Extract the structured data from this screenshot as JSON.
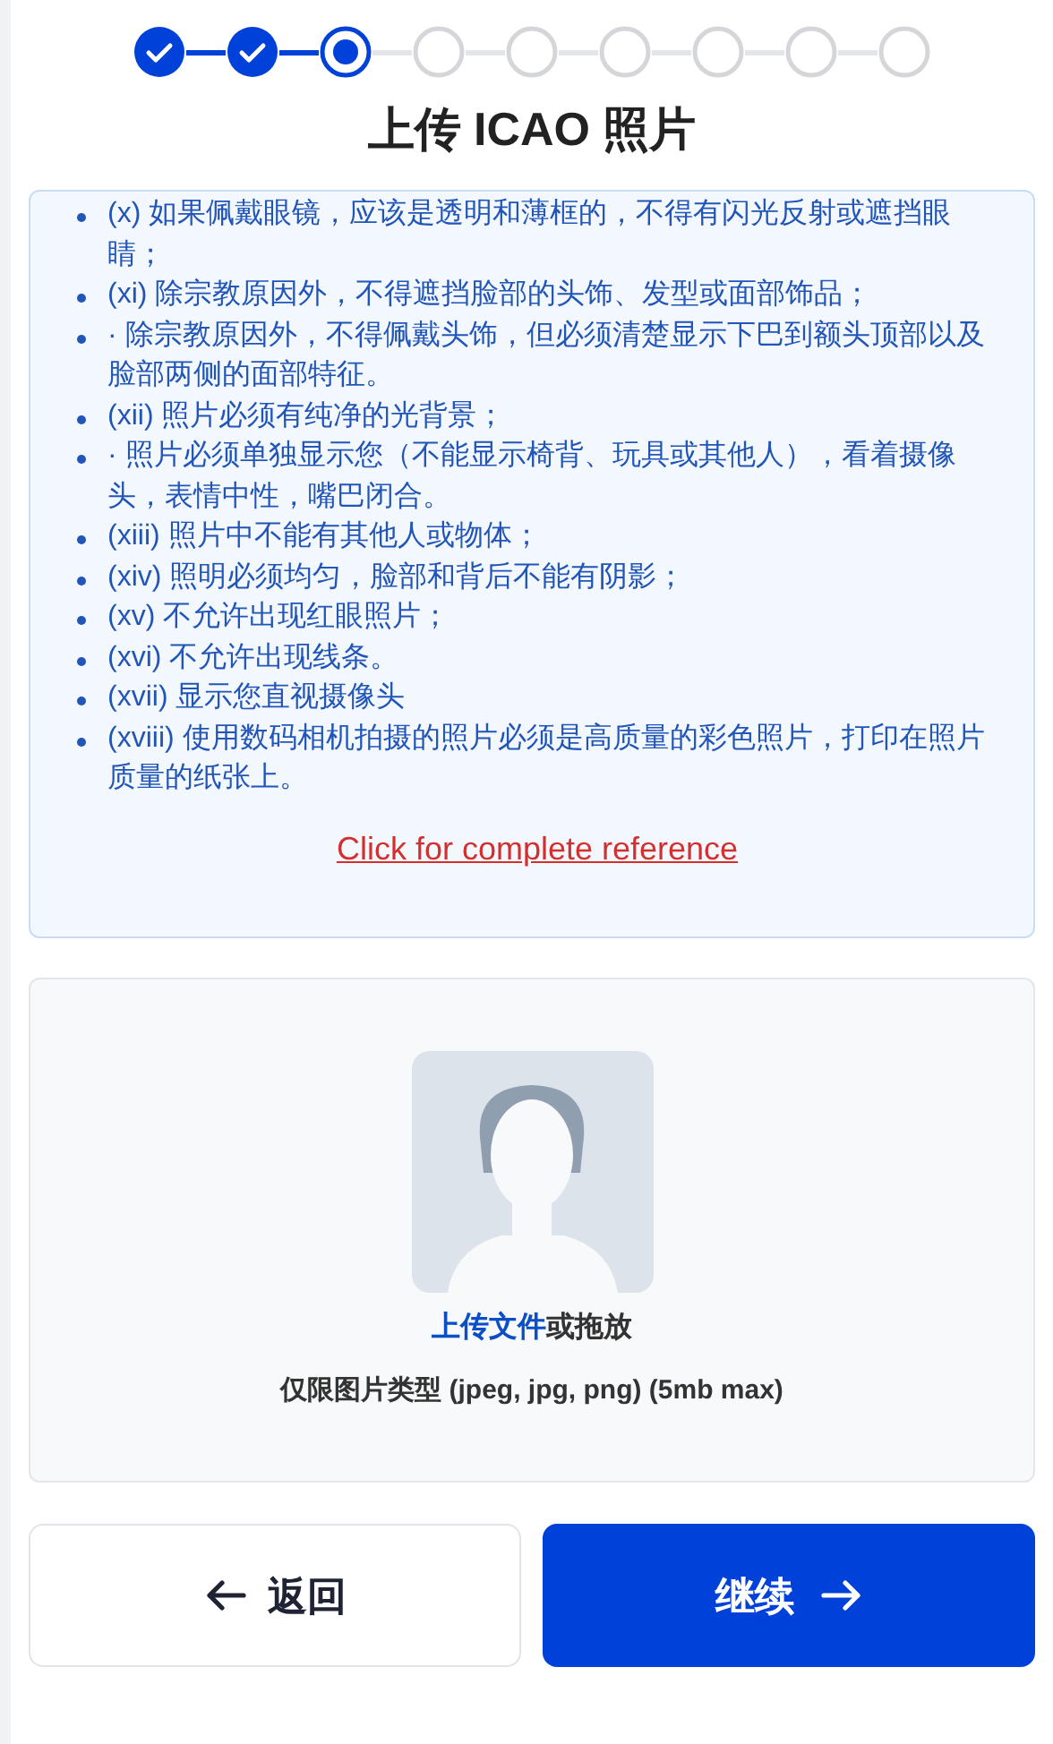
{
  "stepper": {
    "steps": [
      {
        "completed": true,
        "selected": false
      },
      {
        "completed": true,
        "selected": false
      },
      {
        "completed": false,
        "selected": true
      },
      {
        "completed": false,
        "selected": false
      },
      {
        "completed": false,
        "selected": false
      },
      {
        "completed": false,
        "selected": false
      },
      {
        "completed": false,
        "selected": false
      },
      {
        "completed": false,
        "selected": false
      },
      {
        "completed": false,
        "selected": false
      }
    ]
  },
  "title": "上传 ICAO 照片",
  "requirements": {
    "items": [
      "(x) 如果佩戴眼镜，应该是透明和薄框的，不得有闪光反射或遮挡眼睛；",
      "(xi) 除宗教原因外，不得遮挡脸部的头饰、发型或面部饰品；",
      "· 除宗教原因外，不得佩戴头饰，但必须清楚显示下巴到额头顶部以及脸部两侧的面部特征。",
      "(xii) 照片必须有纯净的光背景；",
      "· 照片必须单独显示您（不能显示椅背、玩具或其他人），看着摄像头，表情中性，嘴巴闭合。",
      "(xiii) 照片中不能有其他人或物体；",
      "(xiv) 照明必须均匀，脸部和背后不能有阴影；",
      "(xv) 不允许出现红眼照片；",
      "(xvi) 不允许出现线条。",
      "(xvii) 显示您直视摄像头",
      "(xviii) 使用数码相机拍摄的照片必须是高质量的彩色照片，打印在照片质量的纸张上。"
    ],
    "link": "Click for complete reference"
  },
  "upload": {
    "link": "上传文件",
    "prompt": "或拖放",
    "hint": "仅限图片类型 (jpeg, jpg, png) (5mb max)"
  },
  "buttons": {
    "back": "返回",
    "next": "继续"
  }
}
